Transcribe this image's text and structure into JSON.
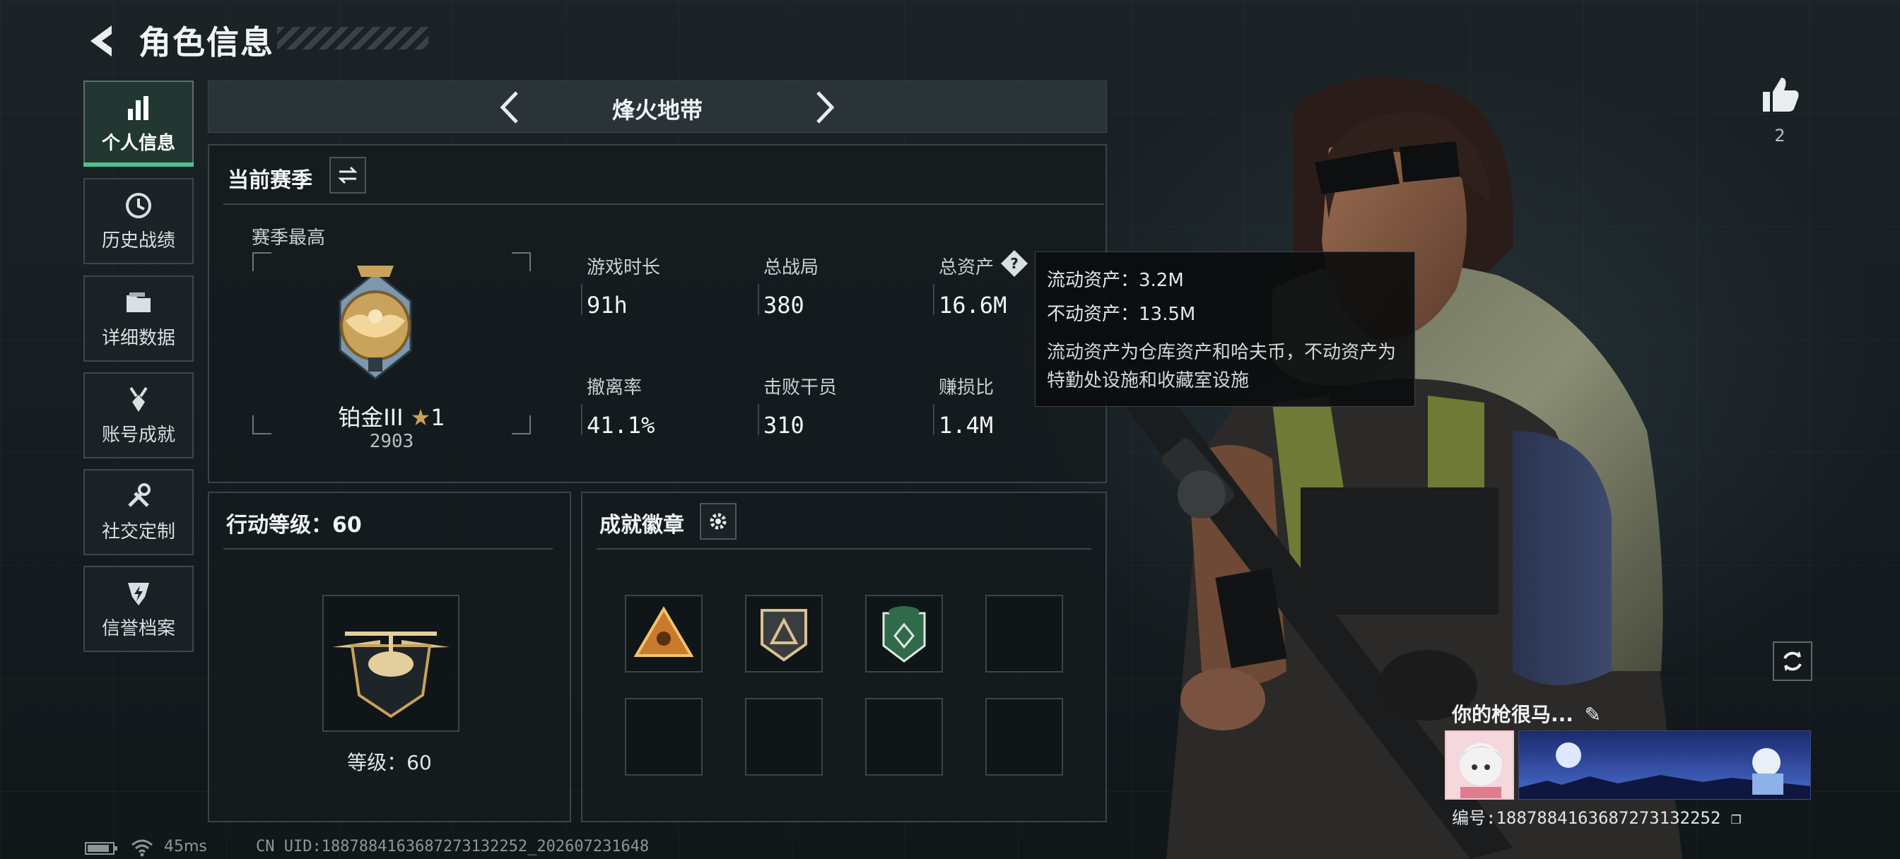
{
  "header": {
    "title": "角色信息"
  },
  "sidebar": {
    "items": [
      {
        "label": "个人信息",
        "icon": "bar-chart-icon",
        "active": true
      },
      {
        "label": "历史战绩",
        "icon": "clock-history-icon",
        "active": false
      },
      {
        "label": "详细数据",
        "icon": "folder-icon",
        "active": false
      },
      {
        "label": "账号成就",
        "icon": "medal-icon",
        "active": false
      },
      {
        "label": "社交定制",
        "icon": "tools-icon",
        "active": false
      },
      {
        "label": "信誉档案",
        "icon": "shield-bolt-icon",
        "active": false
      }
    ]
  },
  "mode": {
    "name": "烽火地带"
  },
  "season": {
    "title": "当前赛季",
    "best_label": "赛季最高",
    "rank_name": "铂金III",
    "rank_stars": "1",
    "rank_points": "2903",
    "stats": [
      {
        "label": "游戏时长",
        "value": "91h"
      },
      {
        "label": "总战局",
        "value": "380"
      },
      {
        "label": "总资产",
        "value": "16.6M"
      },
      {
        "label": "撤离率",
        "value": "41.1%"
      },
      {
        "label": "击败干员",
        "value": "310"
      },
      {
        "label": "赚损比",
        "value": "1.4M"
      }
    ]
  },
  "tooltip": {
    "liquid": "流动资产：3.2M",
    "fixed": "不动资产：13.5M",
    "desc": "流动资产为仓库资产和哈夫币，不动资产为特勤处设施和收藏室设施"
  },
  "level": {
    "title": "行动等级：60",
    "label": "等级：60"
  },
  "achievements": {
    "title": "成就徽章"
  },
  "profile": {
    "likes": "2",
    "name": "你的枪很马...",
    "id": "编号:1887884163687273132252"
  },
  "footer": {
    "ping": "45ms",
    "uid": "CN UID:1887884163687273132252_202607231648"
  },
  "colors": {
    "accent": "#4fc38b",
    "gold": "#c9a25b",
    "panel_border": "#39444a"
  }
}
